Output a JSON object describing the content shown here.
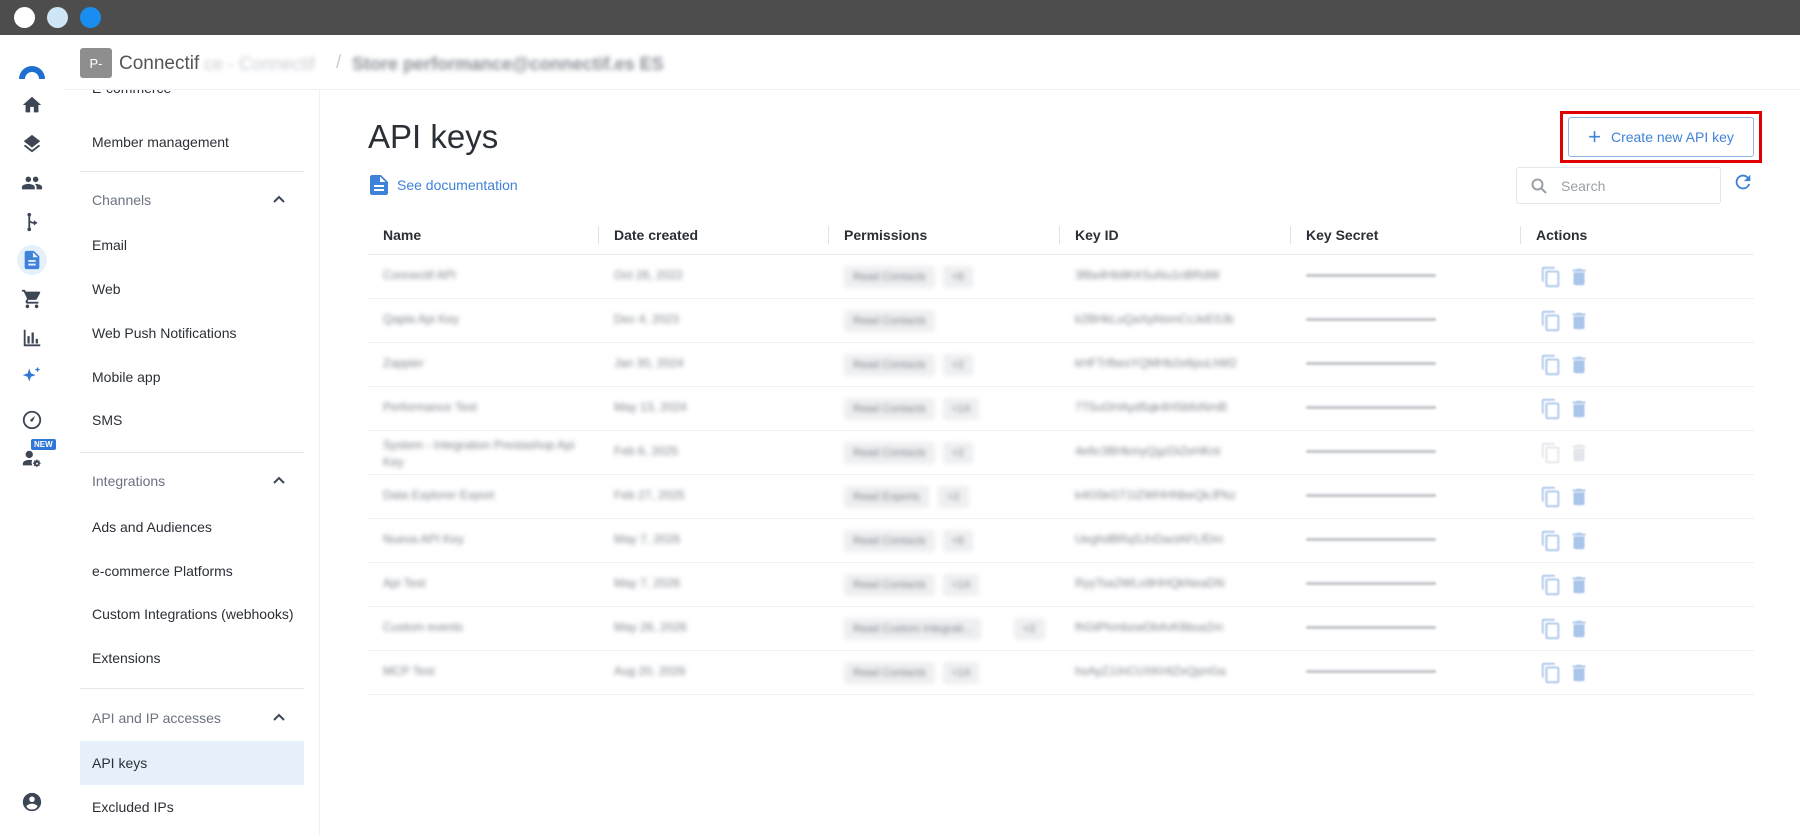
{
  "window": {
    "controls": [
      "close",
      "minimize",
      "maximize"
    ]
  },
  "rail": {
    "logo": "connectif-logo",
    "icons": [
      {
        "name": "home-icon"
      },
      {
        "name": "layers-icon"
      },
      {
        "name": "people-icon"
      },
      {
        "name": "workflow-icon"
      },
      {
        "name": "document-icon",
        "active": true
      },
      {
        "name": "cart-icon"
      },
      {
        "name": "analytics-icon"
      },
      {
        "name": "ai-sparkle-icon",
        "badge": "NEW"
      },
      {
        "name": "dashboard-gauge-icon"
      },
      {
        "name": "user-settings-icon"
      }
    ],
    "account_icon": "account-circle-icon"
  },
  "header": {
    "avatar_text": "P-",
    "brand": "Connectif",
    "store_blurred": "ce - Connectif",
    "separator": "/",
    "store_name_blurred": "Store performance@connectif.es ES"
  },
  "nav": {
    "items_top": [
      "E-commerce",
      "Member management"
    ],
    "sections": [
      {
        "title": "Channels",
        "items": [
          "Email",
          "Web",
          "Web Push Notifications",
          "Mobile app",
          "SMS"
        ]
      },
      {
        "title": "Integrations",
        "items": [
          "Ads and Audiences",
          "e-commerce Platforms",
          "Custom Integrations (webhooks)",
          "Extensions"
        ]
      },
      {
        "title": "API and IP accesses",
        "items": [
          "API keys",
          "Excluded IPs"
        ]
      }
    ],
    "active_item": "API keys"
  },
  "main": {
    "title": "API keys",
    "doc_link": "See documentation",
    "create_button": "Create new API key",
    "search_placeholder": "Search",
    "columns": [
      "Name",
      "Date created",
      "Permissions",
      "Key ID",
      "Key Secret",
      "Actions"
    ],
    "rows": [
      {
        "name": "Connectif API",
        "date": "Oct 26, 2022",
        "permission": "Read Contacts",
        "extra": "+6",
        "key_id": "3f8a4Hb9KK5uNu1nBRdW"
      },
      {
        "name": "Qapla Api Key",
        "date": "Dec 4, 2023",
        "permission": "Read Contacts",
        "extra": "",
        "key_id": "k2BHkLuQaXpNsmCcJeE0Jb"
      },
      {
        "name": "Zappier",
        "date": "Jan 30, 2024",
        "permission": "Read Contacts",
        "extra": "+2",
        "key_id": "kHFTrfbesYQMHb2e6puLhM2"
      },
      {
        "name": "Performance Test",
        "date": "May 13, 2024",
        "permission": "Read Contacts",
        "extra": "+14",
        "key_id": "7T5uGHAyd5qk4HSbfoNmB"
      },
      {
        "name": "System - Integration Prestashop Api Key",
        "date": "Feb 6, 2025",
        "permission": "Read Contacts",
        "extra": "+2",
        "key_id": "4e6c3BHkmyQgzDiZeHKnt",
        "disabled": true
      },
      {
        "name": "Data Explorer Export",
        "date": "Feb 27, 2025",
        "permission": "Read Exports",
        "extra": "+2",
        "key_id": "k4G5kGT1IZWHHNbeQkJPkz"
      },
      {
        "name": "Nueva API Key",
        "date": "May 7, 2026",
        "permission": "Read Contacts",
        "extra": "+6",
        "key_id": "UeghdBRqSJnDactAFLfDm"
      },
      {
        "name": "Api Test",
        "date": "May 7, 2026",
        "permission": "Read Contacts",
        "extra": "+14",
        "key_id": "RyyTsa2WLo9HHQkNeaDN"
      },
      {
        "name": "Custom events",
        "date": "May 26, 2026",
        "permission": "Read Custom Integrati...",
        "extra": "+2",
        "key_id": "fhGtPhmbzwDb4vK6bua2m"
      },
      {
        "name": "MCP Test",
        "date": "Aug 20, 2026",
        "permission": "Read Contacts",
        "extra": "+14",
        "key_id": "hsAyZJJnCUXKHtZeQpnGa"
      }
    ]
  },
  "colors": {
    "accent": "#3f82d9",
    "highlight": "#e00000",
    "active_bg": "#e6f0fb"
  }
}
